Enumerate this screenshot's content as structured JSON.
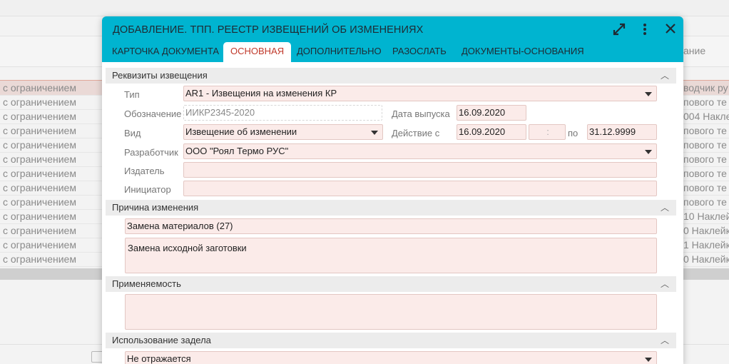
{
  "background": {
    "header_right": "ание",
    "rows": [
      {
        "left": "с ограничением",
        "right": "водчик ру",
        "selected": true
      },
      {
        "left": "с ограничением",
        "right": "пового те"
      },
      {
        "left": "с ограничением",
        "right": "004 Наклей"
      },
      {
        "left": "с ограничением",
        "right": "пового те"
      },
      {
        "left": "с ограничением",
        "right": "пового те"
      },
      {
        "left": "с ограничением",
        "right": "пового те"
      },
      {
        "left": "с ограничением",
        "right": "пового те"
      },
      {
        "left": "с ограничением",
        "right": "пового те"
      },
      {
        "left": "с ограничением",
        "right": "пового те"
      },
      {
        "left": "с ограничением",
        "right": "10 Наклей"
      },
      {
        "left": "с ограничением",
        "right": "0 Наклейк"
      },
      {
        "left": "с ограничением",
        "right": "1 Наклейк"
      },
      {
        "left": "с ограничением",
        "right": "0 Наклейк"
      }
    ]
  },
  "dialog": {
    "title": "ДОБАВЛЕНИЕ. ТПП. РЕЕСТР ИЗВЕЩЕНИЙ ОБ ИЗМЕНЕНИЯХ",
    "icons": {
      "expand": "expand-icon",
      "menu": "more-vertical-icon",
      "close": "close-icon"
    },
    "tabs": [
      {
        "label": "Карточка документа"
      },
      {
        "label": "Основная",
        "active": true
      },
      {
        "label": "Дополнительно"
      },
      {
        "label": "Разослать"
      },
      {
        "label": "Документы-основания"
      }
    ]
  },
  "sections": {
    "requisites": {
      "title": "Реквизиты извещения",
      "type_label": "Тип",
      "type_value": "AR1 - Извещения на изменения КР",
      "designation_label": "Обозначение",
      "designation_placeholder": "ИИКР2345-2020",
      "issue_date_label": "Дата выпуска",
      "issue_date_value": "16.09.2020",
      "kind_label": "Вид",
      "kind_value": "Извещение об изменении",
      "valid_label": "Действие  с",
      "valid_from": "16.09.2020",
      "valid_time_placeholder": ":",
      "valid_to_label": "по",
      "valid_to": "31.12.9999",
      "developer_label": "Разработчик",
      "developer_value": "ООО \"Роял Термо РУС\"",
      "publisher_label": "Издатель",
      "publisher_value": "",
      "initiator_label": "Инициатор",
      "initiator_value": ""
    },
    "reason": {
      "title": "Причина изменения",
      "reason_value": "Замена материалов (27)",
      "reason_text": "Замена исходной заготовки"
    },
    "applicability": {
      "title": "Применяемость",
      "value": ""
    },
    "backlog": {
      "title": "Использование задела",
      "value": "Не отражается"
    }
  },
  "colors": {
    "header": "#00b4d0",
    "active_tab_text": "#c0392b",
    "field_bg": "#fbebe9"
  }
}
